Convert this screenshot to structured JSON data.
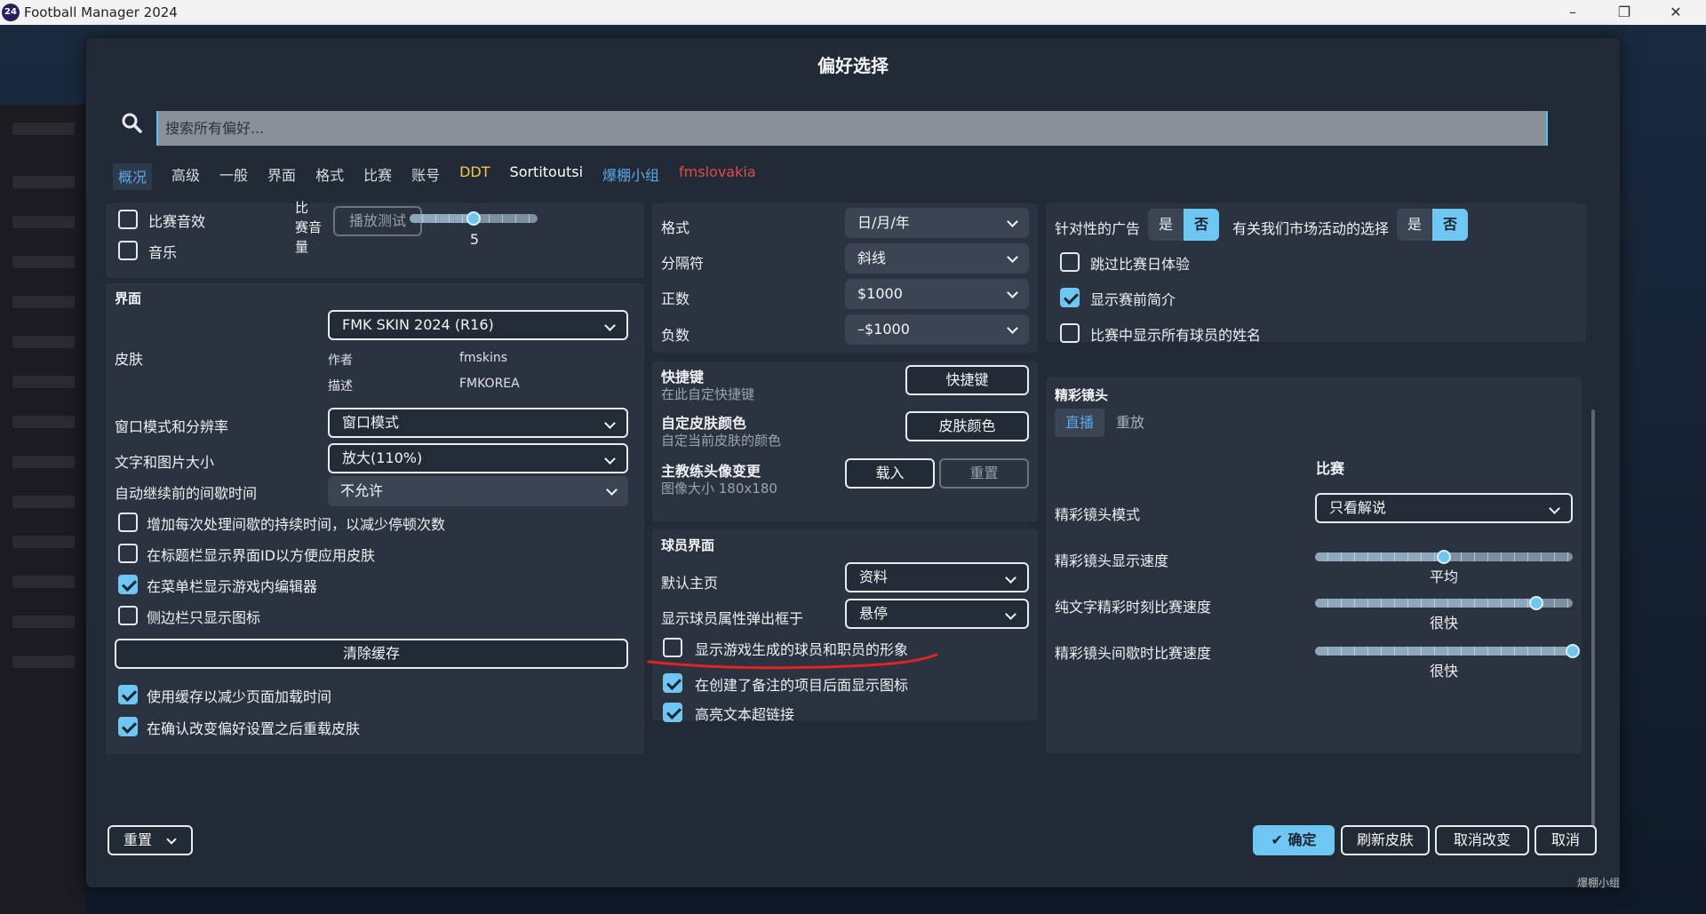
{
  "window": {
    "title": "Football Manager 2024",
    "logo_text": "24"
  },
  "modal": {
    "title": "偏好选择"
  },
  "search": {
    "placeholder": "搜索所有偏好..."
  },
  "tabs": [
    {
      "label": "概况",
      "color": "#5aa8e6"
    },
    {
      "label": "高级",
      "color": "#d8dce2"
    },
    {
      "label": "一般",
      "color": "#d8dce2"
    },
    {
      "label": "界面",
      "color": "#d8dce2"
    },
    {
      "label": "格式",
      "color": "#d8dce2"
    },
    {
      "label": "比赛",
      "color": "#d8dce2"
    },
    {
      "label": "账号",
      "color": "#d8dce2"
    },
    {
      "label": "DDT",
      "color": "#f2c94c"
    },
    {
      "label": "Sortitoutsi",
      "color": "#ffffff"
    },
    {
      "label": "爆棚小组",
      "color": "#5aa8e6"
    },
    {
      "label": "fmslovakia",
      "color": "#e04a4a"
    }
  ],
  "sound": {
    "match_sfx": "比赛音效",
    "music": "音乐",
    "volume_label_1": "比",
    "volume_label_2": "赛音",
    "volume_label_3": "量",
    "play_test": "播放测试",
    "volume_value": "5",
    "volume_fraction": 0.5
  },
  "interface": {
    "title": "界面",
    "skin_label": "皮肤",
    "skin_value": "FMK SKIN 2024 (R16)",
    "author_label": "作者",
    "author_value": "fmskins",
    "desc_label": "描述",
    "desc_value": "FMKOREA",
    "window_label": "窗口模式和分辨率",
    "window_value": "窗口模式",
    "size_label": "文字和图片大小",
    "size_value": "放大(110%)",
    "pause_label": "自动继续前的间歇时间",
    "pause_value": "不允许",
    "cb1": "增加每次处理间歇的持续时间，以减少停顿次数",
    "cb2": "在标题栏显示界面ID以方便应用皮肤",
    "cb3": "在菜单栏显示游戏内编辑器",
    "cb4": "侧边栏只显示图标",
    "clear_cache": "清除缓存",
    "cb5": "使用缓存以减少页面加载时间",
    "cb6": "在确认改变偏好设置之后重载皮肤"
  },
  "format": {
    "format_label": "格式",
    "format_value": "日/月/年",
    "sep_label": "分隔符",
    "sep_value": "斜线",
    "pos_label": "正数",
    "pos_value": "$1000",
    "neg_label": "负数",
    "neg_value": "–$1000"
  },
  "shortcuts": {
    "title": "快捷键",
    "desc": "在此自定快捷键",
    "btn": "快捷键",
    "skin_color_title": "自定皮肤颜色",
    "skin_color_desc": "自定当前皮肤的颜色",
    "skin_color_btn": "皮肤颜色",
    "avatar_title": "主教练头像变更",
    "avatar_desc": "图像大小 180x180",
    "load_btn": "载入",
    "reset_btn": "重置"
  },
  "player_ui": {
    "title": "球员界面",
    "home_label": "默认主页",
    "home_value": "资料",
    "popup_label": "显示球员属性弹出框于",
    "popup_value": "悬停",
    "cb1": "显示游戏生成的球员和职员的形象",
    "cb2": "在创建了备注的项目后面显示图标",
    "cb3": "高亮文本超链接"
  },
  "privacy": {
    "ads_label": "针对性的广告",
    "yes": "是",
    "no": "否",
    "marketing_label": "有关我们市场活动的选择",
    "cb1": "跳过比赛日体验",
    "cb2": "显示赛前简介",
    "cb3": "比赛中显示所有球员的姓名"
  },
  "highlights": {
    "title": "精彩镜头",
    "tab_live": "直播",
    "tab_replay": "重放",
    "col_header": "比赛",
    "mode_label": "精彩镜头模式",
    "mode_value": "只看解说",
    "speed_label": "精彩镜头显示速度",
    "speed_value": "平均",
    "speed_fraction": 0.5,
    "text_speed_label": "纯文字精彩时刻比赛速度",
    "text_speed_value": "很快",
    "text_speed_fraction": 0.86,
    "break_speed_label": "精彩镜头间歇时比赛速度",
    "break_speed_value": "很快",
    "break_speed_fraction": 1.0
  },
  "footer": {
    "reset": "重置",
    "confirm": "确定",
    "refresh_skin": "刷新皮肤",
    "cancel_changes": "取消改变",
    "cancel": "取消"
  },
  "watermark": "爆棚小组"
}
